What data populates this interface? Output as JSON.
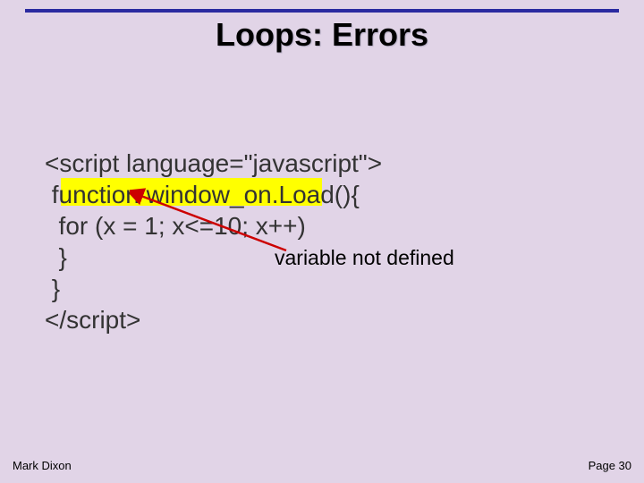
{
  "title": "Loops: Errors",
  "code": {
    "line1": "<script language=\"javascript\">",
    "line2": " function window_on.Load(){",
    "line3": "  for (x = 1; x<=10; x++)",
    "line4": "  }",
    "line5": " }",
    "line6": "</script>"
  },
  "annotation": "variable not defined",
  "footer": {
    "author": "Mark Dixon",
    "page": "Page 30"
  }
}
